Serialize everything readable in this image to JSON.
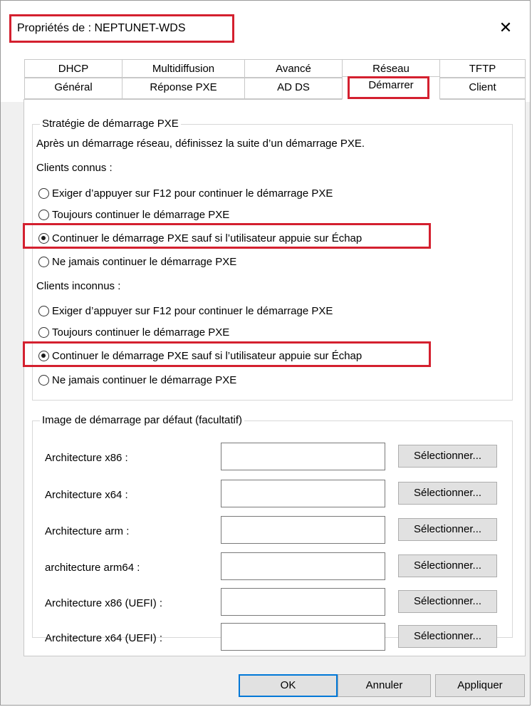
{
  "window": {
    "title": "Propriétés de : NEPTUNET-WDS",
    "close_glyph": "✕"
  },
  "tabs": {
    "row1": [
      "DHCP",
      "Multidiffusion",
      "Avancé",
      "Réseau",
      "TFTP"
    ],
    "row2": [
      "Général",
      "Réponse PXE",
      "AD DS",
      "Démarrer",
      "Client"
    ],
    "active": "Démarrer"
  },
  "boot_policy": {
    "legend": "Stratégie de démarrage PXE",
    "description": "Après un démarrage réseau, définissez la suite d’un démarrage PXE.",
    "known_clients": {
      "label": "Clients connus :",
      "options": [
        {
          "label": "Exiger d’appuyer sur F12 pour continuer le démarrage PXE",
          "selected": false
        },
        {
          "label": "Toujours continuer le démarrage PXE",
          "selected": false
        },
        {
          "label": "Continuer le démarrage PXE sauf si l’utilisateur appuie sur Échap",
          "selected": true
        },
        {
          "label": "Ne jamais continuer le démarrage PXE",
          "selected": false
        }
      ]
    },
    "unknown_clients": {
      "label": "Clients inconnus :",
      "options": [
        {
          "label": "Exiger d’appuyer sur F12 pour continuer le démarrage PXE",
          "selected": false
        },
        {
          "label": "Toujours continuer le démarrage PXE",
          "selected": false
        },
        {
          "label": "Continuer le démarrage PXE sauf si l’utilisateur appuie sur Échap",
          "selected": true
        },
        {
          "label": "Ne jamais continuer le démarrage PXE",
          "selected": false
        }
      ]
    }
  },
  "default_boot_image": {
    "legend": "Image de démarrage par défaut (facultatif)",
    "rows": [
      {
        "label": "Architecture x86 :",
        "value": "",
        "button": "Sélectionner..."
      },
      {
        "label": "Architecture x64 :",
        "value": "",
        "button": "Sélectionner..."
      },
      {
        "label": "Architecture arm :",
        "value": "",
        "button": "Sélectionner..."
      },
      {
        "label": "architecture arm64 :",
        "value": "",
        "button": "Sélectionner..."
      },
      {
        "label": "Architecture x86 (UEFI) :",
        "value": "",
        "button": "Sélectionner..."
      },
      {
        "label": "Architecture x64 (UEFI) :",
        "value": "",
        "button": "Sélectionner..."
      }
    ]
  },
  "footer": {
    "ok": "OK",
    "cancel": "Annuler",
    "apply": "Appliquer"
  },
  "colors": {
    "highlight": "#d4202f",
    "focus": "#0078d7"
  }
}
